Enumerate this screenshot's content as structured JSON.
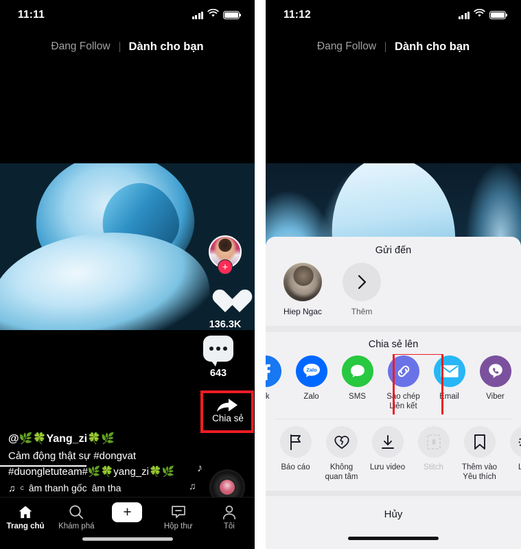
{
  "left_phone": {
    "status": {
      "time": "11:11",
      "signal_icon": "cellular-signal-icon",
      "wifi_icon": "wifi-icon",
      "battery_icon": "battery-full-icon"
    },
    "top_tabs": {
      "following": "Đang Follow",
      "for_you": "Dành cho bạn"
    },
    "rail": {
      "avatar_icon": "creator-avatar",
      "follow_icon": "plus-follow-icon",
      "like_icon": "heart-icon",
      "like_count": "136.3K",
      "comment_icon": "comment-bubble-icon",
      "comment_count": "643",
      "share_icon": "share-arrow-icon",
      "share_label": "Chia sẻ",
      "disc_icon": "music-disc-icon"
    },
    "caption": {
      "username": "@🌿🍀Yang_zi🍀🌿",
      "line1": "Cảm động thật sự #dongvat",
      "line2": "#duongletuteam#🌿🍀yang_zi🍀🌿",
      "music_note_icon": "music-note-icon",
      "music_prefix": "c",
      "music_text": "âm thanh gốc",
      "music_text2": "âm tha"
    },
    "tabbar": [
      {
        "label": "Trang chủ",
        "icon": "home-icon",
        "active": true
      },
      {
        "label": "Khám phá",
        "icon": "search-icon",
        "active": false
      },
      {
        "label": "",
        "icon": "create-plus-icon",
        "active": false
      },
      {
        "label": "Hộp thư",
        "icon": "inbox-icon",
        "active": false
      },
      {
        "label": "Tôi",
        "icon": "profile-person-icon",
        "active": false
      }
    ]
  },
  "right_phone": {
    "status": {
      "time": "11:12",
      "signal_icon": "cellular-signal-icon",
      "wifi_icon": "wifi-icon",
      "battery_icon": "battery-full-icon"
    },
    "top_tabs": {
      "following": "Đang Follow",
      "for_you": "Dành cho bạn"
    },
    "sheet": {
      "send_to_title": "Gửi đến",
      "contacts": [
        {
          "name": "Hiep Ngac",
          "icon": "contact-avatar"
        }
      ],
      "more": {
        "label": "Thêm",
        "icon": "chevron-right-icon"
      },
      "share_to_title": "Chia sẻ lên",
      "apps": [
        {
          "label": "ok",
          "icon": "facebook-icon",
          "color": "#1877f2",
          "partial": true
        },
        {
          "label": "Zalo",
          "icon": "zalo-icon",
          "color": "#0068ff"
        },
        {
          "label": "SMS",
          "icon": "sms-icon",
          "color": "#28c840"
        },
        {
          "label": "Sao chép\nLiên kết",
          "icon": "copy-link-icon",
          "color": "#6a72e8",
          "highlighted": true
        },
        {
          "label": "Email",
          "icon": "email-icon",
          "color": "#29b6f6"
        },
        {
          "label": "Viber",
          "icon": "viber-icon",
          "color": "#7b519d"
        }
      ],
      "actions": [
        {
          "label": "Báo cáo",
          "icon": "flag-icon"
        },
        {
          "label": "Không\nquan tâm",
          "icon": "broken-heart-icon"
        },
        {
          "label": "Lưu video",
          "icon": "download-icon"
        },
        {
          "label": "Stitch",
          "icon": "stitch-icon",
          "disabled": true
        },
        {
          "label": "Thêm vào\nYêu thích",
          "icon": "bookmark-icon"
        },
        {
          "label": "Live",
          "icon": "live-photo-icon",
          "partial": true
        }
      ],
      "cancel": "Hủy"
    }
  },
  "colors": {
    "highlight_red": "#ee1c25",
    "tiktok_pink": "#fe2c55",
    "tiktok_cyan": "#25f4ee",
    "sheet_bg": "#f1f1f3"
  }
}
